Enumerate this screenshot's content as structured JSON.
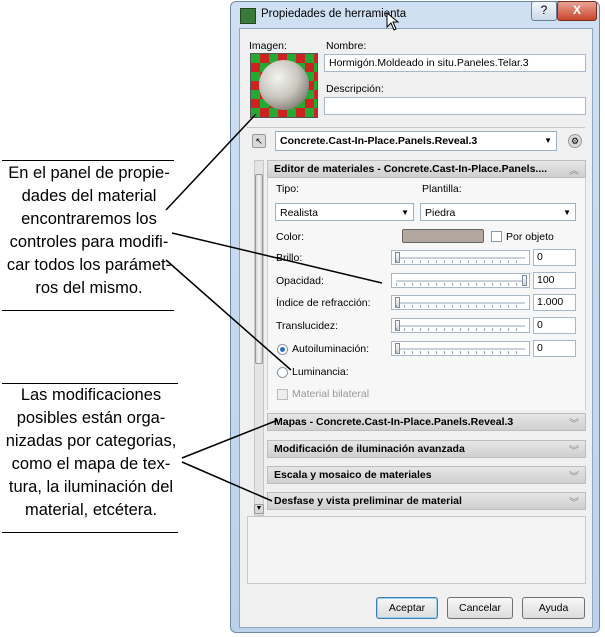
{
  "annotations": {
    "top": [
      "En el panel de propie-",
      "dades del material",
      "encontraremos los",
      "controles para modifi-",
      "car todos los parámet-",
      "ros del mismo."
    ],
    "bottom": [
      "Las modificaciones",
      "posibles están orga-",
      "nizadas por categorias,",
      "como el mapa de tex-",
      "tura, la iluminación del",
      "material, etcétera."
    ]
  },
  "window": {
    "title": "Propiedades de herramienta",
    "help_glyph": "?",
    "close_glyph": "X"
  },
  "header": {
    "image_label": "Imagen:",
    "name_label": "Nombre:",
    "name_value": "Hormigón.Moldeado in situ.Paneles.Telar.3",
    "description_label": "Descripción:",
    "description_value": ""
  },
  "material_select": {
    "value": "Concrete.Cast-In-Place.Panels.Reveal.3"
  },
  "editor": {
    "heading": "Editor de materiales - Concrete.Cast-In-Place.Panels....",
    "tipo_label": "Tipo:",
    "tipo_value": "Realista",
    "plantilla_label": "Plantilla:",
    "plantilla_value": "Piedra",
    "color_label": "Color:",
    "color_swatch": "#b2a8a0",
    "por_objeto_label": "Por objeto",
    "brillo_label": "Brillo:",
    "brillo_value": "0",
    "opacidad_label": "Opacidad:",
    "opacidad_value": "100",
    "refraccion_label": "Índice de refracción:",
    "refraccion_value": "1.000",
    "translucidez_label": "Translucidez:",
    "translucidez_value": "0",
    "autoiluminacion_label": "Autoiluminación:",
    "autoiluminacion_value": "0",
    "luminancia_label": "Luminancia:",
    "material_bilateral_label": "Material bilateral"
  },
  "sections": [
    {
      "label": "Mapas - Concrete.Cast-In-Place.Panels.Reveal.3"
    },
    {
      "label": "Modificación de iluminación avanzada"
    },
    {
      "label": "Escala y mosaico de materiales"
    },
    {
      "label": "Desfase y vista preliminar de material"
    }
  ],
  "buttons": {
    "ok": "Aceptar",
    "cancel": "Cancelar",
    "help": "Ayuda"
  }
}
